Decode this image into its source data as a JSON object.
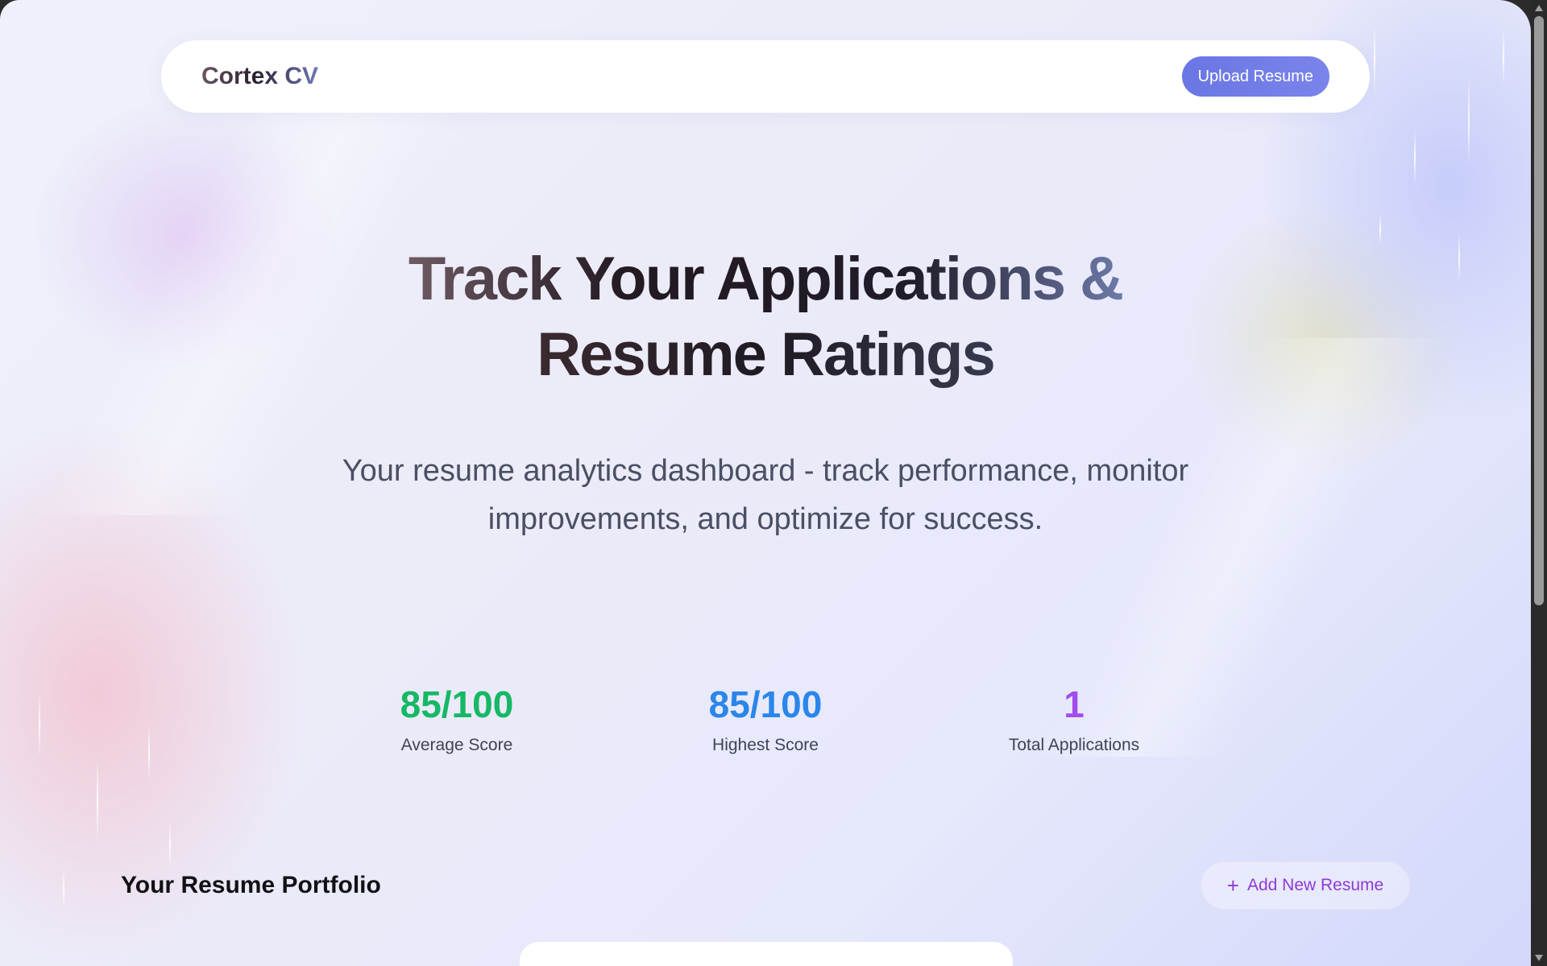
{
  "navbar": {
    "brand": "Cortex CV",
    "upload_label": "Upload Resume"
  },
  "hero": {
    "title_line1": "Track Your Applications &",
    "title_line2": "Resume Ratings",
    "subtitle": "Your resume analytics dashboard - track performance, monitor improvements, and optimize for success."
  },
  "stats": [
    {
      "value": "85/100",
      "label": "Average Score",
      "color": "#16b865"
    },
    {
      "value": "85/100",
      "label": "Highest Score",
      "color": "#2a86ea"
    },
    {
      "value": "1",
      "label": "Total Applications",
      "color": "#a24cea"
    }
  ],
  "portfolio": {
    "title": "Your Resume Portfolio",
    "add_label": "Add New Resume",
    "add_icon": "plus-icon"
  },
  "colors": {
    "accent": "#6a76e4",
    "add_text": "#8f3ad6"
  }
}
